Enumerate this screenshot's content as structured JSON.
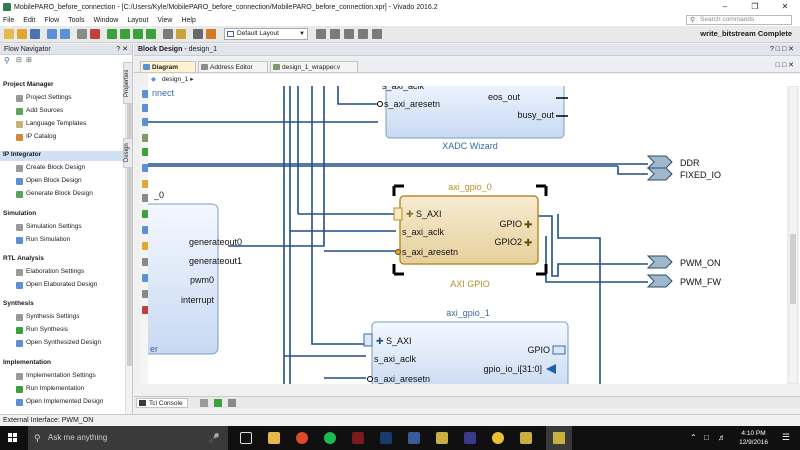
{
  "window": {
    "title": "MobilePARO_before_connection - [C:/Users/Kyle/MobilePARO_before_connection/MobilePARO_before_connection.xpr] - Vivado 2016.2"
  },
  "menu": {
    "items": [
      "File",
      "Edit",
      "Flow",
      "Tools",
      "Window",
      "Layout",
      "View",
      "Help"
    ],
    "search_placeholder": "Search commands"
  },
  "toolbar": {
    "layout_value": "Default Layout",
    "status": "write_bitstream Complete"
  },
  "flow_navigator": {
    "title": "Flow Navigator",
    "header_icons": "? ✕",
    "sections": [
      {
        "label": "Project Manager",
        "items": [
          "Project Settings",
          "Add Sources",
          "Language Templates",
          "IP Catalog"
        ]
      },
      {
        "label": "IP Integrator",
        "items": [
          "Create Block Design",
          "Open Block Design",
          "Generate Block Design"
        ]
      },
      {
        "label": "Simulation",
        "items": [
          "Simulation Settings",
          "Run Simulation"
        ]
      },
      {
        "label": "RTL Analysis",
        "items": [
          "Elaboration Settings",
          "Open Elaborated Design"
        ]
      },
      {
        "label": "Synthesis",
        "items": [
          "Synthesis Settings",
          "Run Synthesis",
          "Open Synthesized Design"
        ]
      },
      {
        "label": "Implementation",
        "items": [
          "Implementation Settings",
          "Run Implementation",
          "Open Implemented Design"
        ]
      }
    ]
  },
  "block_design": {
    "title": "Block Design",
    "name": "design_1"
  },
  "side_tabs": {
    "properties": "Properties",
    "design": "Design"
  },
  "tabs": [
    {
      "label": "Diagram"
    },
    {
      "label": "Address Editor"
    },
    {
      "label": "design_1_wrapper.v"
    }
  ],
  "breadcrumb": "design_1",
  "diagram": {
    "xadc": {
      "name": "XADC Wizard",
      "ports_in": [
        "s_axi_aclk",
        "s_axi_aresetn"
      ],
      "ports_out": [
        "eos_out",
        "busy_out"
      ]
    },
    "gpio0": {
      "instance": "axi_gpio_0",
      "name": "AXI GPIO",
      "ports_in": [
        "S_AXI",
        "s_axi_aclk",
        "s_axi_aresetn"
      ],
      "ports_out": [
        "GPIO",
        "GPIO2"
      ]
    },
    "gpio1": {
      "instance": "axi_gpio_1",
      "ports_in": [
        "S_AXI",
        "s_axi_aclk",
        "s_axi_aresetn"
      ],
      "ports_out": [
        "GPIO",
        "gpio_io_i[31:0]"
      ]
    },
    "left_block": {
      "title_fragment": "_0",
      "top_fragment": "nnect",
      "bottom_fragment": "er",
      "ports": [
        "generateout0",
        "generateout1",
        "pwm0",
        "interrupt"
      ]
    },
    "external_ports": [
      "DDR",
      "FIXED_IO",
      "PWM_ON",
      "PWM_FW"
    ]
  },
  "bottom_tabs": {
    "tcl_console": "Tcl Console"
  },
  "statusbar": {
    "text": "External Interface: PWM_ON"
  },
  "taskbar": {
    "search_placeholder": "Ask me anything",
    "time": "4:10 PM",
    "date": "12/9/2016"
  }
}
